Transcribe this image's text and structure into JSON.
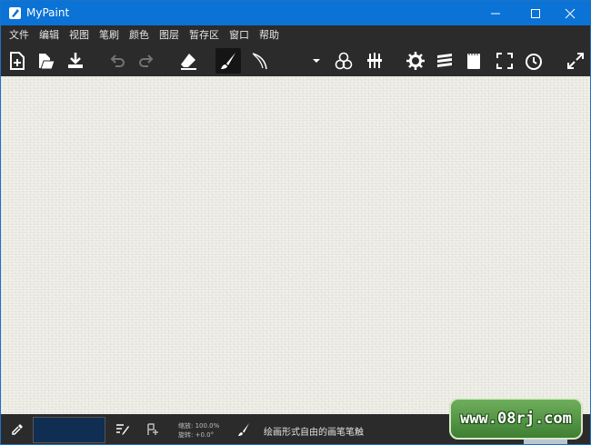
{
  "window": {
    "title": "MyPaint",
    "controls": [
      "minimize-icon",
      "maximize-icon",
      "close-icon"
    ],
    "titlebar_color": "#0b72d6"
  },
  "menu": {
    "items": [
      {
        "label": "文件"
      },
      {
        "label": "编辑"
      },
      {
        "label": "视图"
      },
      {
        "label": "笔刷"
      },
      {
        "label": "颜色"
      },
      {
        "label": "图层"
      },
      {
        "label": "暂存区"
      },
      {
        "label": "窗口"
      },
      {
        "label": "帮助"
      }
    ]
  },
  "toolbar": {
    "tools": [
      {
        "name": "new-document-icon"
      },
      {
        "name": "open-file-icon"
      },
      {
        "name": "save-download-icon"
      },
      {
        "name": "undo-icon",
        "state": "disabled"
      },
      {
        "name": "redo-icon",
        "state": "disabled"
      },
      {
        "name": "eraser-icon"
      },
      {
        "name": "freehand-brush-icon",
        "state": "active"
      },
      {
        "name": "ink-pen-icon"
      },
      {
        "name": "dropdown-arrow-icon"
      },
      {
        "name": "color-circles-icon"
      },
      {
        "name": "brushes-icon"
      },
      {
        "name": "settings-gear-icon"
      },
      {
        "name": "layers-icon"
      },
      {
        "name": "scratchpad-notepad-icon"
      },
      {
        "name": "fullscreen-icon"
      },
      {
        "name": "clock-icon"
      },
      {
        "name": "expand-icon"
      }
    ]
  },
  "canvas": {
    "color": "#ecebe3"
  },
  "statusbar": {
    "current_color": "#0f2e52",
    "zoom_label": "缩放: 100.0%",
    "rotate_label": "旋转: +0.0°",
    "status_text": "绘画形式自由的画笔笔触"
  },
  "watermark": {
    "text": "www.08rj.com"
  }
}
